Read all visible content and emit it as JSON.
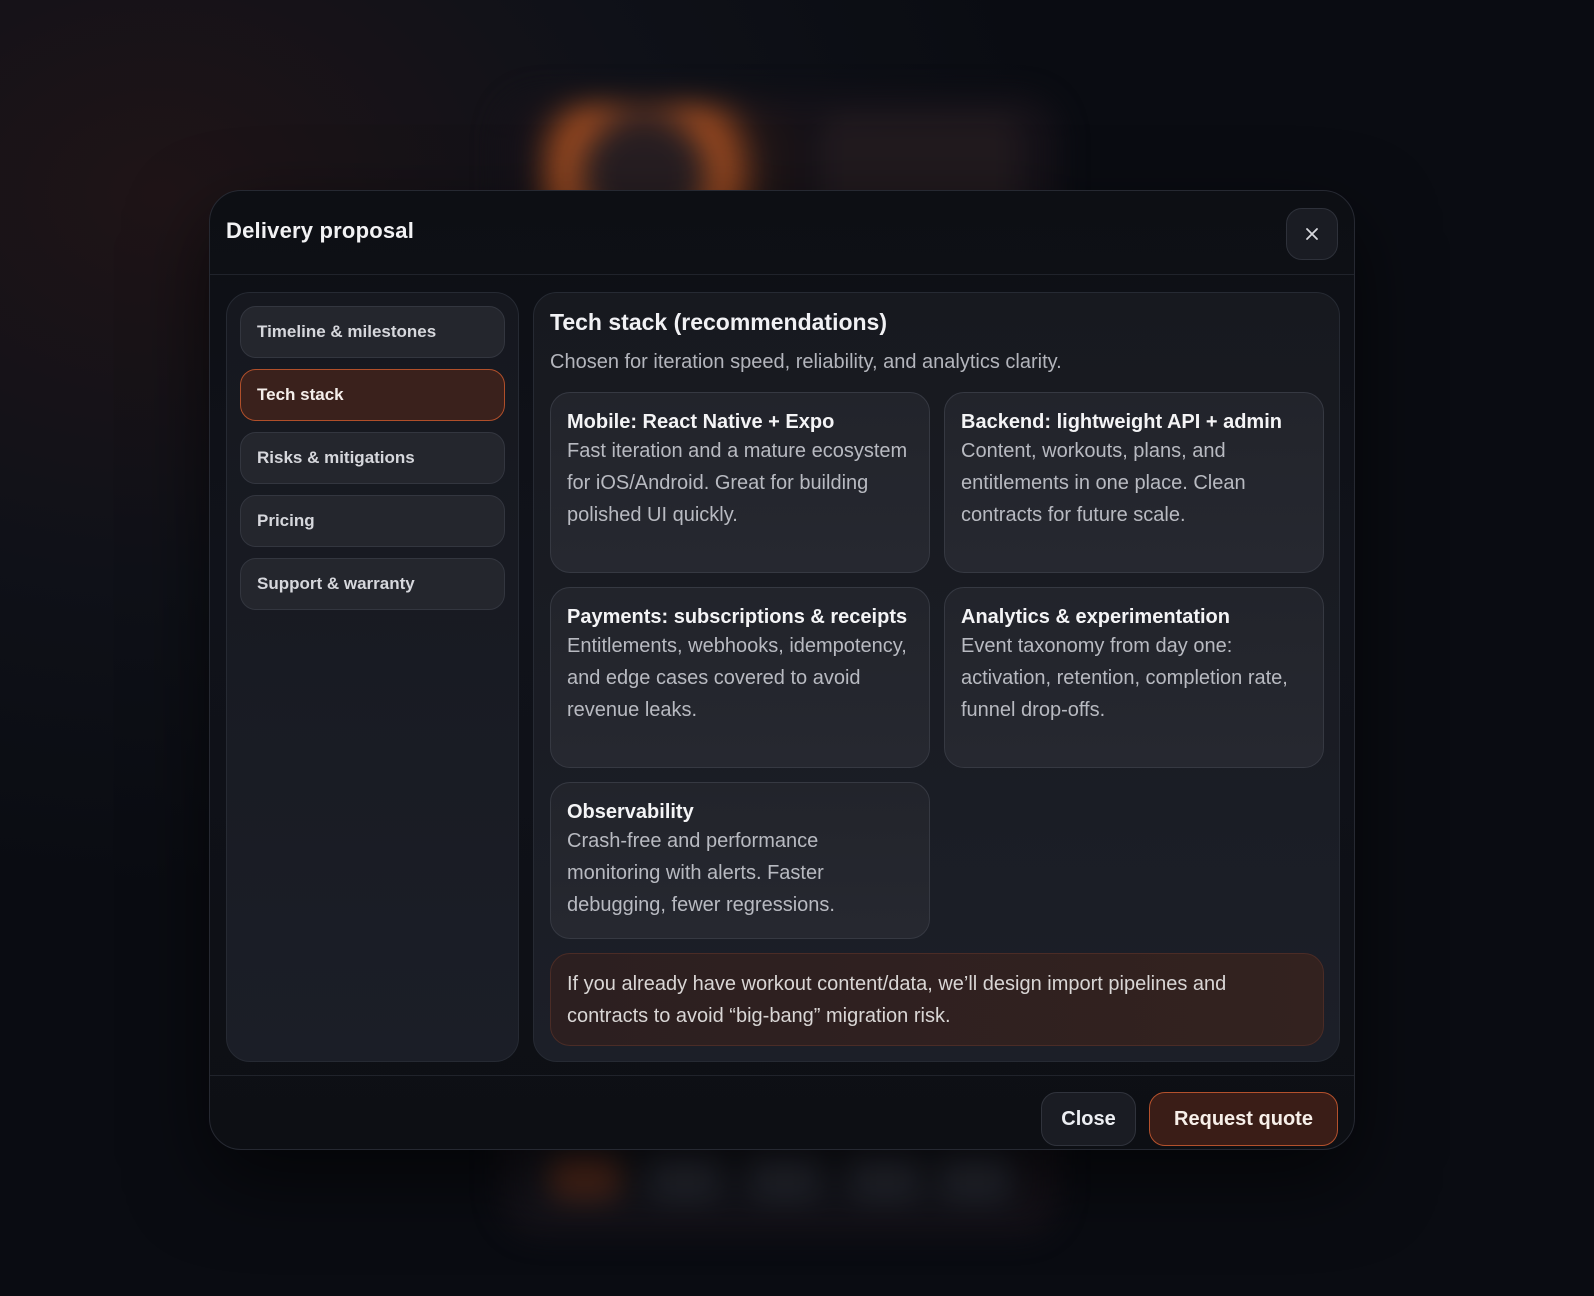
{
  "modal": {
    "title": "Delivery proposal",
    "close_icon": "close-icon"
  },
  "sidebar": {
    "items": [
      {
        "label": "Timeline & milestones",
        "active": false
      },
      {
        "label": "Tech stack",
        "active": true
      },
      {
        "label": "Risks & mitigations",
        "active": false
      },
      {
        "label": "Pricing",
        "active": false
      },
      {
        "label": "Support & warranty",
        "active": false
      }
    ]
  },
  "content": {
    "title": "Tech stack (recommendations)",
    "subtitle": "Chosen for iteration speed, reliability, and analytics clarity.",
    "cards": [
      {
        "title": "Mobile: React Native + Expo",
        "body": "Fast iteration and a mature ecosystem for iOS/Android. Great for building polished UI quickly."
      },
      {
        "title": "Backend: lightweight API + admin",
        "body": "Content, workouts, plans, and entitlements in one place. Clean contracts for future scale."
      },
      {
        "title": "Payments: subscriptions & receipts",
        "body": "Entitlements, webhooks, idempotency, and edge cases covered to avoid revenue leaks."
      },
      {
        "title": "Analytics & experimentation",
        "body": "Event taxonomy from day one: activation, retention, completion rate, funnel drop-offs."
      },
      {
        "title": "Observability",
        "body": "Crash-free and performance monitoring with alerts. Faster debugging, fewer regressions."
      }
    ],
    "callout": "If you already have workout content/data, we’ll design import pipelines and contracts to avoid “big-bang” migration risk."
  },
  "footer": {
    "close_label": "Close",
    "quote_label": "Request quote"
  },
  "colors": {
    "accent": "#b04f2a",
    "accent_bg": "#3a211c",
    "modal_bg": "#0d0f14"
  }
}
